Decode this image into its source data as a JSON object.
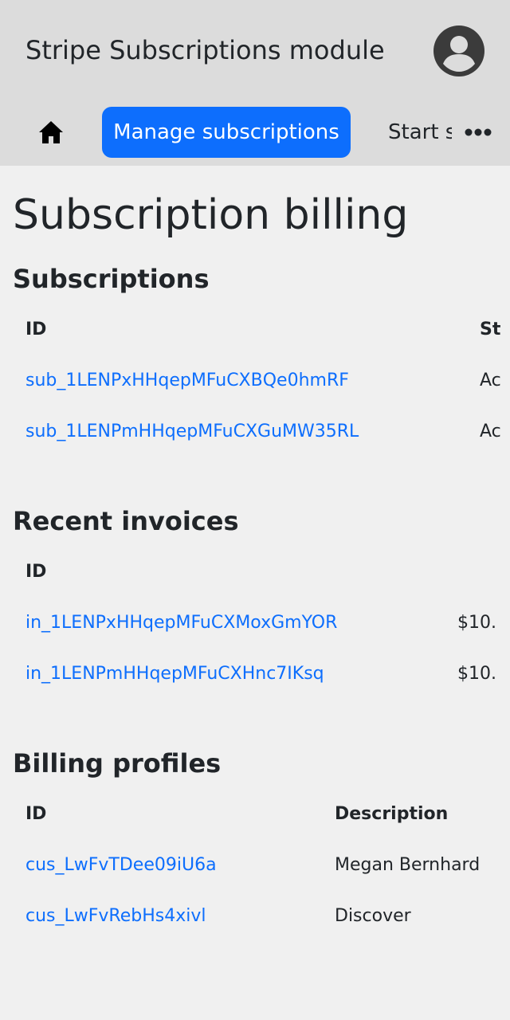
{
  "header": {
    "app_title": "Stripe Subscriptions module",
    "avatar_icon": "account-circle-icon"
  },
  "nav": {
    "home_icon": "home-icon",
    "items": [
      {
        "label": "Manage subscriptions",
        "active": true
      },
      {
        "label": "Start s",
        "active": false
      }
    ],
    "more_icon": "more-horizontal-icon"
  },
  "page": {
    "title": "Subscription billing"
  },
  "subscriptions": {
    "title": "Subscriptions",
    "columns": [
      "ID",
      "St"
    ],
    "rows": [
      {
        "id": "sub_1LENPxHHqepMFuCXBQe0hmRF",
        "status": "Ac"
      },
      {
        "id": "sub_1LENPmHHqepMFuCXGuMW35RL",
        "status": "Ac"
      }
    ]
  },
  "invoices": {
    "title": "Recent invoices",
    "columns": [
      "ID",
      ""
    ],
    "rows": [
      {
        "id": "in_1LENPxHHqepMFuCXMoxGmYOR",
        "amount": "$10."
      },
      {
        "id": "in_1LENPmHHqepMFuCXHnc7IKsq",
        "amount": "$10."
      }
    ]
  },
  "billing_profiles": {
    "title": "Billing profiles",
    "columns": [
      "ID",
      "Description"
    ],
    "rows": [
      {
        "id": "cus_LwFvTDee09iU6a",
        "description": "Megan Bernhard"
      },
      {
        "id": "cus_LwFvRebHs4xivl",
        "description": "Discover"
      }
    ]
  },
  "colors": {
    "header_bg": "#dcdcdc",
    "page_bg": "#f0f0f0",
    "accent": "#0d6efd",
    "text": "#212529"
  }
}
